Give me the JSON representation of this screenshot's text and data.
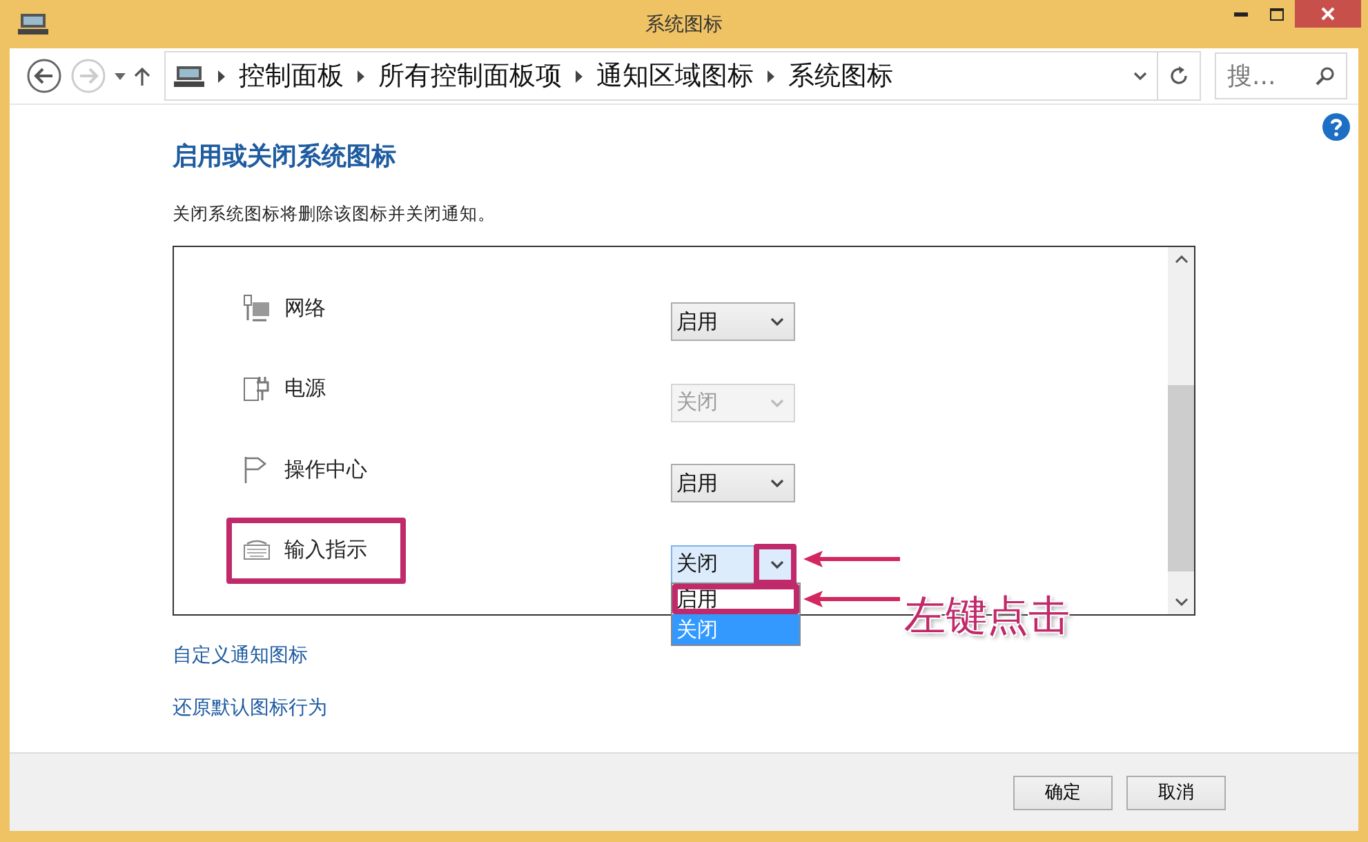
{
  "window": {
    "title": "系统图标"
  },
  "address_bar": {
    "path": [
      "控制面板",
      "所有控制面板项",
      "通知区域图标",
      "系统图标"
    ]
  },
  "search": {
    "placeholder": "搜..."
  },
  "heading": "启用或关闭系统图标",
  "description": "关闭系统图标将删除该图标并关闭通知。",
  "icons": [
    {
      "name": "网络",
      "kind": "network",
      "value": "启用",
      "disabled": false,
      "expanded": false,
      "highlighted": false
    },
    {
      "name": "电源",
      "kind": "power",
      "value": "关闭",
      "disabled": true,
      "expanded": false,
      "highlighted": false
    },
    {
      "name": "操作中心",
      "kind": "flag",
      "value": "启用",
      "disabled": false,
      "expanded": false,
      "highlighted": false
    },
    {
      "name": "输入指示",
      "kind": "keyboard",
      "value": "关闭",
      "disabled": false,
      "expanded": true,
      "highlighted": true,
      "options": [
        {
          "label": "启用",
          "selected": false,
          "highlighted": true
        },
        {
          "label": "关闭",
          "selected": true,
          "highlighted": false
        }
      ]
    }
  ],
  "links": [
    "自定义通知图标",
    "还原默认图标行为"
  ],
  "buttons": [
    "确定",
    "取消"
  ],
  "annotation": {
    "text": "左键点击"
  }
}
